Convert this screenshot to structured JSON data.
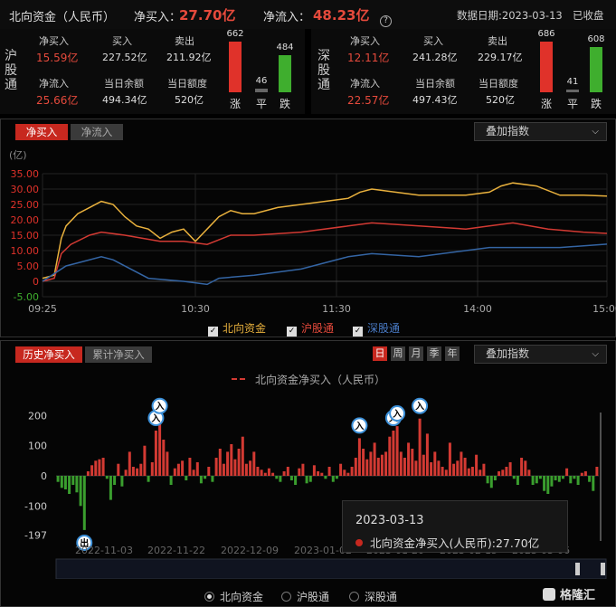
{
  "header": {
    "title": "北向资金（人民币）",
    "net_buy_label": "净买入：",
    "net_buy_value": "27.70亿",
    "net_flow_label": "净流入：",
    "net_flow_value": "48.23亿",
    "date_label": "数据日期:2023-03-13",
    "status": "已收盘"
  },
  "sh": {
    "title": "沪股通",
    "net_buy_label": "净买入",
    "net_buy": "15.59亿",
    "buy_label": "买入",
    "buy": "227.52亿",
    "sell_label": "卖出",
    "sell": "211.92亿",
    "net_flow_label": "净流入",
    "net_flow": "25.66亿",
    "balance_label": "当日余额",
    "balance": "494.34亿",
    "quota_label": "当日额度",
    "quota": "520亿",
    "up": "662",
    "flat": "46",
    "down": "484",
    "up_label": "涨",
    "flat_label": "平",
    "down_label": "跌",
    "up_n": 662,
    "flat_n": 46,
    "down_n": 484
  },
  "sz": {
    "title": "深股通",
    "net_buy_label": "净买入",
    "net_buy": "12.11亿",
    "buy_label": "买入",
    "buy": "241.28亿",
    "sell_label": "卖出",
    "sell": "229.17亿",
    "net_flow_label": "净流入",
    "net_flow": "22.57亿",
    "balance_label": "当日余额",
    "balance": "497.43亿",
    "quota_label": "当日额度",
    "quota": "520亿",
    "up": "686",
    "flat": "41",
    "down": "608",
    "up_label": "涨",
    "flat_label": "平",
    "down_label": "跌",
    "up_n": 686,
    "flat_n": 41,
    "down_n": 608
  },
  "intraday": {
    "tabs": [
      "净买入",
      "净流入"
    ],
    "overlay": "叠加指数",
    "unit": "(亿)",
    "legend": [
      "北向资金",
      "沪股通",
      "深股通"
    ]
  },
  "history": {
    "tabs": [
      "历史净买入",
      "累计净买入"
    ],
    "periods": [
      "日",
      "周",
      "月",
      "季",
      "年"
    ],
    "overlay": "叠加指数",
    "legend_text": "北向资金净买入（人民币）",
    "tooltip_date": "2023-03-13",
    "tooltip_text": "北向资金净买入(人民币):27.70亿",
    "marker_in": "入",
    "marker_out": "出",
    "radios": [
      "北向资金",
      "沪股通",
      "深股通"
    ]
  },
  "watermark": "格隆汇",
  "colors": {
    "red": "#d33a33",
    "green": "#3a9e2e",
    "yellow": "#e9b13d",
    "blue": "#3465a4"
  },
  "chart_data": [
    {
      "type": "line",
      "title": "",
      "ylabel": "(亿)",
      "ylim": [
        -5,
        35
      ],
      "yticks": [
        "35.00",
        "30.00",
        "25.00",
        "20.00",
        "15.00",
        "10.00",
        "5.00",
        "0",
        "-5.00"
      ],
      "xticks": [
        "09:25",
        "10:30",
        "11:30",
        "14:00",
        "15:00"
      ],
      "x_domain": [
        0,
        240
      ],
      "series": [
        {
          "name": "北向资金",
          "color": "#e9b13d",
          "points": [
            [
              0,
              1
            ],
            [
              5,
              2
            ],
            [
              8,
              14
            ],
            [
              10,
              18
            ],
            [
              15,
              22
            ],
            [
              20,
              24
            ],
            [
              25,
              26
            ],
            [
              30,
              25
            ],
            [
              35,
              21
            ],
            [
              40,
              18
            ],
            [
              45,
              17
            ],
            [
              50,
              14
            ],
            [
              55,
              16
            ],
            [
              60,
              17
            ],
            [
              65,
              13
            ],
            [
              70,
              17
            ],
            [
              75,
              21
            ],
            [
              80,
              23
            ],
            [
              85,
              22
            ],
            [
              90,
              22
            ],
            [
              100,
              24
            ],
            [
              110,
              25
            ],
            [
              120,
              26
            ],
            [
              130,
              27
            ],
            [
              135,
              29
            ],
            [
              140,
              30
            ],
            [
              150,
              29
            ],
            [
              160,
              28
            ],
            [
              170,
              28
            ],
            [
              180,
              28
            ],
            [
              190,
              29
            ],
            [
              195,
              31
            ],
            [
              200,
              32
            ],
            [
              210,
              31
            ],
            [
              220,
              28
            ],
            [
              230,
              28
            ],
            [
              240,
              27.7
            ]
          ]
        },
        {
          "name": "沪股通",
          "color": "#d33a33",
          "points": [
            [
              0,
              0
            ],
            [
              5,
              1
            ],
            [
              8,
              9
            ],
            [
              12,
              12
            ],
            [
              20,
              15
            ],
            [
              25,
              16
            ],
            [
              35,
              15
            ],
            [
              50,
              13
            ],
            [
              60,
              13
            ],
            [
              70,
              12
            ],
            [
              80,
              15
            ],
            [
              90,
              15
            ],
            [
              110,
              16
            ],
            [
              130,
              18
            ],
            [
              140,
              19
            ],
            [
              160,
              18
            ],
            [
              180,
              17
            ],
            [
              190,
              18
            ],
            [
              200,
              19
            ],
            [
              215,
              17
            ],
            [
              230,
              16
            ],
            [
              240,
              15.6
            ]
          ]
        },
        {
          "name": "深股通",
          "color": "#3465a4",
          "points": [
            [
              0,
              0
            ],
            [
              10,
              5
            ],
            [
              15,
              6
            ],
            [
              25,
              8
            ],
            [
              30,
              7
            ],
            [
              45,
              1
            ],
            [
              60,
              0
            ],
            [
              70,
              -1
            ],
            [
              75,
              1
            ],
            [
              90,
              2
            ],
            [
              110,
              4
            ],
            [
              130,
              8
            ],
            [
              140,
              9
            ],
            [
              160,
              8
            ],
            [
              180,
              10
            ],
            [
              190,
              11
            ],
            [
              200,
              11
            ],
            [
              220,
              11
            ],
            [
              240,
              12.1
            ]
          ]
        }
      ]
    },
    {
      "type": "bar",
      "title": "",
      "ylim": [
        -197,
        200
      ],
      "yticks": [
        "200",
        "100",
        "0",
        "-100",
        "-197"
      ],
      "xticks": [
        "2022-11-03",
        "2022-11-22",
        "2022-12-09",
        "2023-01-02",
        "2023-01-20",
        "2023-02-15",
        "2023-03-06"
      ],
      "values": [
        -20,
        -40,
        -45,
        -60,
        -30,
        -55,
        -100,
        -180,
        15,
        35,
        50,
        55,
        60,
        -10,
        -80,
        -30,
        40,
        -35,
        20,
        80,
        30,
        25,
        40,
        100,
        -20,
        45,
        150,
        190,
        120,
        80,
        -30,
        25,
        40,
        50,
        -15,
        60,
        20,
        45,
        -25,
        -10,
        30,
        -20,
        60,
        90,
        40,
        80,
        105,
        55,
        90,
        130,
        40,
        50,
        80,
        30,
        20,
        10,
        25,
        10,
        -10,
        -20,
        15,
        30,
        -15,
        -30,
        25,
        40,
        -25,
        -20,
        35,
        15,
        10,
        -10,
        30,
        -20,
        -10,
        40,
        20,
        10,
        30,
        60,
        125,
        90,
        55,
        80,
        110,
        60,
        70,
        80,
        130,
        150,
        165,
        80,
        60,
        110,
        90,
        50,
        190,
        70,
        140,
        45,
        80,
        50,
        30,
        20,
        110,
        40,
        50,
        80,
        60,
        25,
        30,
        70,
        20,
        40,
        -25,
        -40,
        -15,
        15,
        20,
        30,
        45,
        -10,
        -30,
        60,
        50,
        20,
        -30,
        -25,
        -10,
        -50,
        -60,
        -35,
        -15,
        -20,
        -10,
        25,
        -25,
        -10,
        -30,
        10,
        15,
        -20,
        -50,
        30
      ],
      "markers": [
        {
          "index": 7,
          "label": "出"
        },
        {
          "index": 26,
          "label": "入"
        },
        {
          "index": 27,
          "label": "入"
        },
        {
          "index": 80,
          "label": "入"
        },
        {
          "index": 89,
          "label": "入"
        },
        {
          "index": 90,
          "label": "入"
        },
        {
          "index": 96,
          "label": "入"
        }
      ]
    }
  ]
}
